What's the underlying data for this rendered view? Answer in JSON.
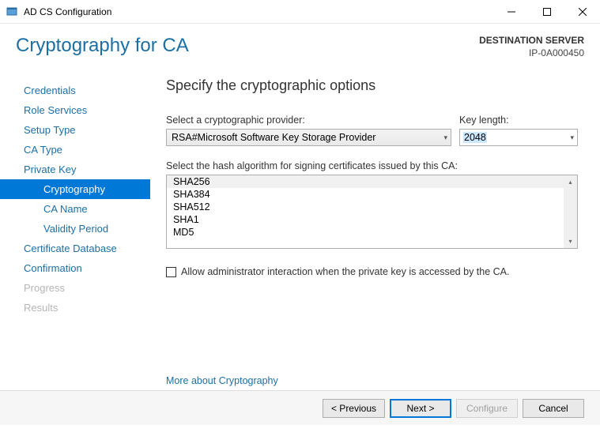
{
  "window": {
    "title": "AD CS Configuration"
  },
  "header": {
    "page_title": "Cryptography for CA",
    "destination_label": "DESTINATION SERVER",
    "destination_value": "IP-0A000450"
  },
  "sidebar": {
    "items": [
      {
        "label": "Credentials",
        "indent": 0,
        "state": "normal"
      },
      {
        "label": "Role Services",
        "indent": 0,
        "state": "normal"
      },
      {
        "label": "Setup Type",
        "indent": 0,
        "state": "normal"
      },
      {
        "label": "CA Type",
        "indent": 0,
        "state": "normal"
      },
      {
        "label": "Private Key",
        "indent": 0,
        "state": "normal"
      },
      {
        "label": "Cryptography",
        "indent": 1,
        "state": "selected"
      },
      {
        "label": "CA Name",
        "indent": 1,
        "state": "normal"
      },
      {
        "label": "Validity Period",
        "indent": 1,
        "state": "normal"
      },
      {
        "label": "Certificate Database",
        "indent": 0,
        "state": "normal"
      },
      {
        "label": "Confirmation",
        "indent": 0,
        "state": "normal"
      },
      {
        "label": "Progress",
        "indent": 0,
        "state": "disabled"
      },
      {
        "label": "Results",
        "indent": 0,
        "state": "disabled"
      }
    ]
  },
  "main": {
    "heading": "Specify the cryptographic options",
    "provider_label": "Select a cryptographic provider:",
    "provider_value": "RSA#Microsoft Software Key Storage Provider",
    "keylen_label": "Key length:",
    "keylen_value": "2048",
    "hash_label": "Select the hash algorithm for signing certificates issued by this CA:",
    "hash_options": [
      "SHA256",
      "SHA384",
      "SHA512",
      "SHA1",
      "MD5"
    ],
    "hash_selected_index": 0,
    "checkbox_label": "Allow administrator interaction when the private key is accessed by the CA.",
    "checkbox_checked": false,
    "more_link": "More about Cryptography"
  },
  "footer": {
    "previous": "< Previous",
    "next": "Next >",
    "configure": "Configure",
    "cancel": "Cancel"
  }
}
